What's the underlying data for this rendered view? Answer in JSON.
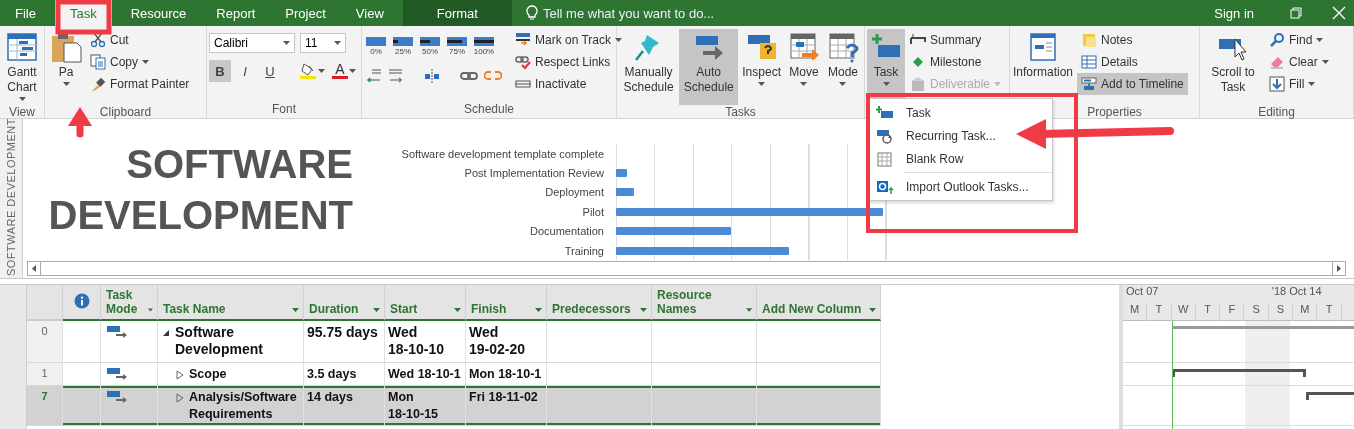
{
  "tabs": [
    {
      "label": "File",
      "kind": "tab",
      "selected": false
    },
    {
      "label": "Task",
      "kind": "tab",
      "selected": true
    },
    {
      "label": "Resource",
      "kind": "tab",
      "selected": false
    },
    {
      "label": "Report",
      "kind": "tab",
      "selected": false
    },
    {
      "label": "Project",
      "kind": "tab",
      "selected": false
    },
    {
      "label": "View",
      "kind": "tab",
      "selected": false
    },
    {
      "label": "Format",
      "kind": "contextual",
      "selected": false
    }
  ],
  "tell_me": {
    "placeholder": "Tell me what you want to do..."
  },
  "sign_in": "Sign in",
  "ribbon": {
    "groups": [
      {
        "kind": "buttons",
        "label": "View",
        "columns": [
          [
            {
              "kind": "large",
              "label": "Gantt Chart",
              "dropdown": true,
              "selected": false
            }
          ]
        ]
      },
      {
        "kind": "buttons",
        "label": "Clipboard",
        "columns": [
          [
            {
              "kind": "large",
              "label": "Pa",
              "dropdown": true,
              "selected": false
            }
          ],
          [
            {
              "kind": "small",
              "label": "Cut",
              "selected": false
            },
            {
              "kind": "small",
              "label": "Copy",
              "dropdown": true,
              "selected": false
            },
            {
              "kind": "small",
              "label": "Format Painter",
              "selected": false
            }
          ]
        ]
      },
      {
        "kind": "font",
        "label": "Font",
        "family": "Calibri",
        "size": "11",
        "styles": [
          {
            "label": "B",
            "selected": true
          },
          {
            "label": "I",
            "selected": false
          },
          {
            "label": "U",
            "selected": false
          }
        ],
        "color_label": "A"
      },
      {
        "kind": "schedule",
        "label": "Schedule",
        "percents": [
          "0%",
          "25%",
          "50%",
          "75%",
          "100%"
        ],
        "columns": [
          [
            {
              "kind": "small",
              "label": "Mark on Track",
              "dropdown": true,
              "selected": false
            },
            {
              "kind": "small",
              "label": "Respect Links",
              "selected": false
            },
            {
              "kind": "small",
              "label": "Inactivate",
              "selected": false
            }
          ]
        ]
      },
      {
        "kind": "buttons",
        "label": "Tasks",
        "columns": [
          [
            {
              "kind": "large",
              "label": "Manually Schedule",
              "selected": false
            }
          ],
          [
            {
              "kind": "large",
              "label": "Auto Schedule",
              "selected": true
            }
          ],
          [
            {
              "kind": "large",
              "label": "Inspect",
              "dropdown": true,
              "selected": false
            }
          ],
          [
            {
              "kind": "large",
              "label": "Move",
              "dropdown": true,
              "selected": false
            }
          ],
          [
            {
              "kind": "large",
              "label": "Mode",
              "dropdown": true,
              "selected": false
            }
          ]
        ]
      },
      {
        "kind": "buttons",
        "columns": [
          [
            {
              "kind": "large",
              "label": "Task",
              "dropdown": true,
              "selected": true
            }
          ],
          [
            {
              "kind": "small",
              "label": "Summary",
              "selected": false,
              "disabled": false
            },
            {
              "kind": "small",
              "label": "Milestone",
              "selected": false,
              "disabled": false
            },
            {
              "kind": "small",
              "label": "Deliverable",
              "dropdown": true,
              "selected": false,
              "disabled": true
            }
          ]
        ]
      },
      {
        "kind": "buttons",
        "label": "Properties",
        "columns": [
          [
            {
              "kind": "large",
              "label": "Information",
              "selected": false
            }
          ],
          [
            {
              "kind": "small",
              "label": "Notes",
              "selected": false
            },
            {
              "kind": "small",
              "label": "Details",
              "selected": false
            },
            {
              "kind": "small",
              "label": "Add to Timeline",
              "selected": true
            }
          ]
        ]
      },
      {
        "kind": "buttons",
        "label": "Editing",
        "columns": [
          [
            {
              "kind": "large",
              "label": "Scroll to Task",
              "selected": false
            }
          ],
          [
            {
              "kind": "small",
              "label": "Find",
              "dropdown": true,
              "selected": false
            },
            {
              "kind": "small",
              "label": "Clear",
              "dropdown": true,
              "selected": false
            },
            {
              "kind": "small",
              "label": "Fill",
              "dropdown": true,
              "selected": false
            }
          ]
        ]
      }
    ]
  },
  "task_menu": [
    {
      "label": "Task"
    },
    {
      "label": "Recurring Task..."
    },
    {
      "label": "Blank Row"
    },
    {
      "label": "Import Outlook Tasks..."
    }
  ],
  "timeline": {
    "side_label": "SOFTWARE DEVELOPMENT",
    "title": "SOFTWARE DEVELOPMENT",
    "bars": [
      {
        "label": "Software development template complete"
      },
      {
        "label": "Post Implementation Review"
      },
      {
        "label": "Deployment"
      },
      {
        "label": "Pilot"
      },
      {
        "label": "Documentation"
      },
      {
        "label": "Training"
      }
    ]
  },
  "table": {
    "columns": [
      {
        "label": "Task Mode"
      },
      {
        "label": "Task Name"
      },
      {
        "label": "Duration"
      },
      {
        "label": "Start"
      },
      {
        "label": "Finish"
      },
      {
        "label": "Predecessors"
      },
      {
        "label": "Resource Names"
      },
      {
        "label": "Add New Column"
      }
    ],
    "rows": [
      {
        "id": "0",
        "name": "Software Development",
        "duration": "95.75 days",
        "start": "Wed 18-10-10",
        "finish": "Wed 19-02-20",
        "expanded": true,
        "selected": false,
        "children": [
          {
            "id": "1",
            "name": "Scope",
            "duration": "3.5 days",
            "start": "Wed 18-10-1",
            "finish": "Mon 18-10-1",
            "expanded": false,
            "selected": false
          },
          {
            "id": "7",
            "name": "Analysis/Software Requirements",
            "duration": "14 days",
            "start": "Mon 18-10-15",
            "finish": "Fri 18-11-02",
            "expanded": false,
            "selected": true
          }
        ]
      }
    ]
  },
  "gantt": {
    "weeks": [
      "Oct 07",
      "'18 Oct 14"
    ],
    "days": [
      "M",
      "T",
      "W",
      "T",
      "F",
      "S",
      "S",
      "M",
      "T"
    ]
  }
}
